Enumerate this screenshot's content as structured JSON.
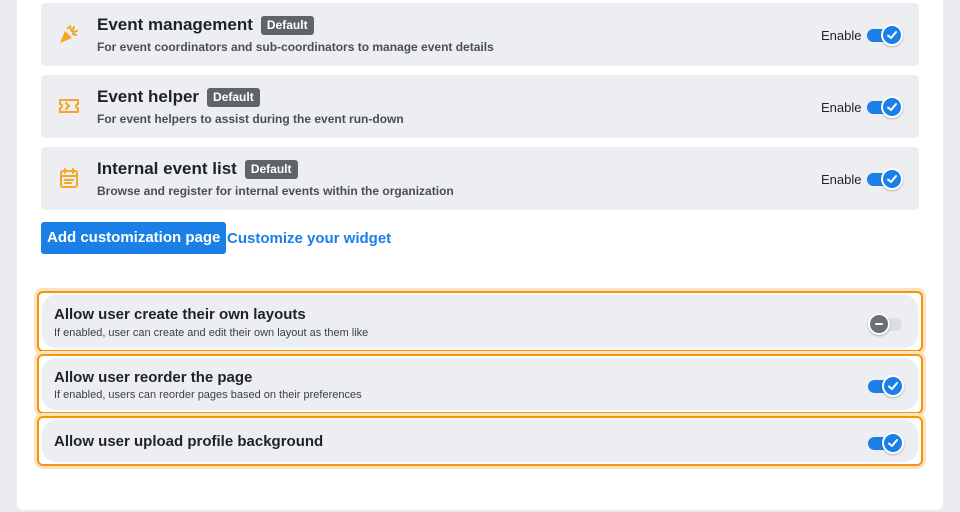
{
  "modules": [
    {
      "icon": "party-popper-icon",
      "title": "Event management",
      "badge": "Default",
      "description": "For event coordinators and sub-coordinators to manage event details",
      "enable_label": "Enable",
      "enabled": true
    },
    {
      "icon": "ticket-icon",
      "title": "Event helper",
      "badge": "Default",
      "description": "For event helpers to assist during the event run-down",
      "enable_label": "Enable",
      "enabled": true
    },
    {
      "icon": "calendar-list-icon",
      "title": "Internal event list",
      "badge": "Default",
      "description": "Browse and register for internal events within the organization",
      "enable_label": "Enable",
      "enabled": true
    }
  ],
  "actions": {
    "add_page_label": "Add customization page",
    "customize_widget_label": "Customize your widget"
  },
  "permissions": [
    {
      "title": "Allow user create their own layouts",
      "description": "If enabled, user can create and edit their own layout as them like",
      "enabled": false
    },
    {
      "title": "Allow user reorder the page",
      "description": "If enabled, users can reorder pages based on their preferences",
      "enabled": true
    },
    {
      "title": "Allow user upload profile background",
      "description": "",
      "enabled": true
    }
  ],
  "colors": {
    "accent": "#1a7fe6",
    "icon_orange": "#f5a623",
    "highlight_border": "#f0960f",
    "badge_bg": "#5f6469"
  }
}
